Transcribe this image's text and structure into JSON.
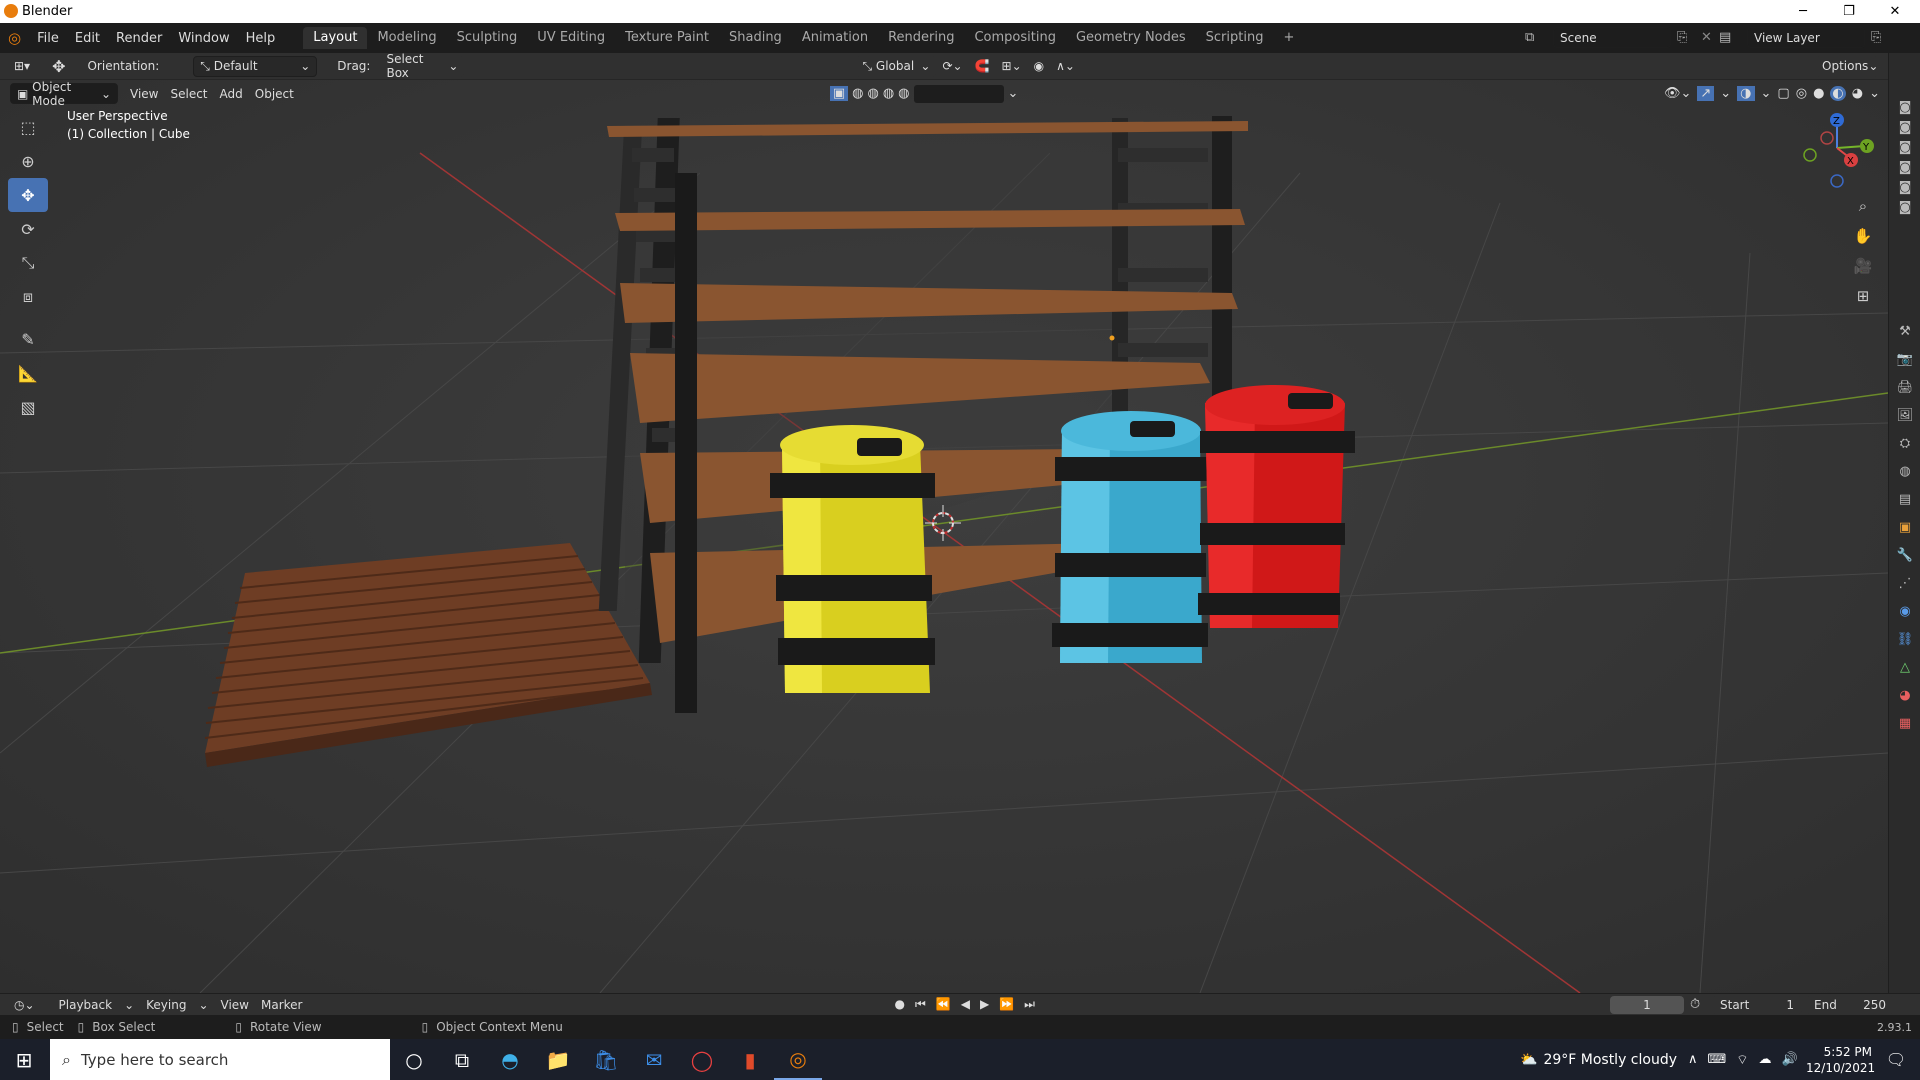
{
  "window": {
    "title": "Blender"
  },
  "window_controls": {
    "minimize": "─",
    "maximize": "❐",
    "close": "✕"
  },
  "menu": {
    "file": "File",
    "edit": "Edit",
    "render": "Render",
    "window": "Window",
    "help": "Help"
  },
  "workspaces": [
    "Layout",
    "Modeling",
    "Sculpting",
    "UV Editing",
    "Texture Paint",
    "Shading",
    "Animation",
    "Rendering",
    "Compositing",
    "Geometry Nodes",
    "Scripting"
  ],
  "active_workspace": "Layout",
  "scene": {
    "name": "Scene",
    "view_layer": "View Layer"
  },
  "tool_header": {
    "orientation_label": "Orientation:",
    "orientation_value": "Default",
    "drag_label": "Drag:",
    "drag_value": "Select Box",
    "transform_space": "Global",
    "options": "Options"
  },
  "viewport_header": {
    "mode": "Object Mode",
    "view": "View",
    "select": "Select",
    "add": "Add",
    "object": "Object"
  },
  "viewport_overlay": {
    "perspective": "User Perspective",
    "collection": "(1) Collection | Cube"
  },
  "gizmo": {
    "z": "Z",
    "x": "X",
    "y": "Y"
  },
  "timeline": {
    "playback": "Playback",
    "keying": "Keying",
    "view": "View",
    "marker": "Marker",
    "current_frame": "1",
    "start_label": "Start",
    "start_value": "1",
    "end_label": "End",
    "end_value": "250"
  },
  "statusbar": {
    "select": "Select",
    "box_select": "Box Select",
    "rotate_view": "Rotate View",
    "context_menu": "Object Context Menu",
    "version": "2.93.1"
  },
  "taskbar": {
    "search_placeholder": "Type here to search",
    "weather": "29°F  Mostly cloudy",
    "time": "5:52 PM",
    "date": "12/10/2021"
  },
  "colors": {
    "accent": "#4772b3",
    "yellow_barrel": "#d9cf1f",
    "blue_barrel": "#3aa8cc",
    "red_barrel": "#d01818",
    "wood": "#8a5530",
    "pallet": "#6e3d24"
  },
  "icons": [
    "blender-logo-icon",
    "editor-type-icon",
    "move-icon",
    "cursor-icon",
    "rotate-icon",
    "scale-icon",
    "transform-icon",
    "annotate-icon",
    "measure-icon",
    "add-cube-icon",
    "select-box-icon",
    "zoom-icon",
    "hand-icon",
    "camera-icon",
    "grid-icon",
    "windows-start-icon",
    "search-icon"
  ]
}
